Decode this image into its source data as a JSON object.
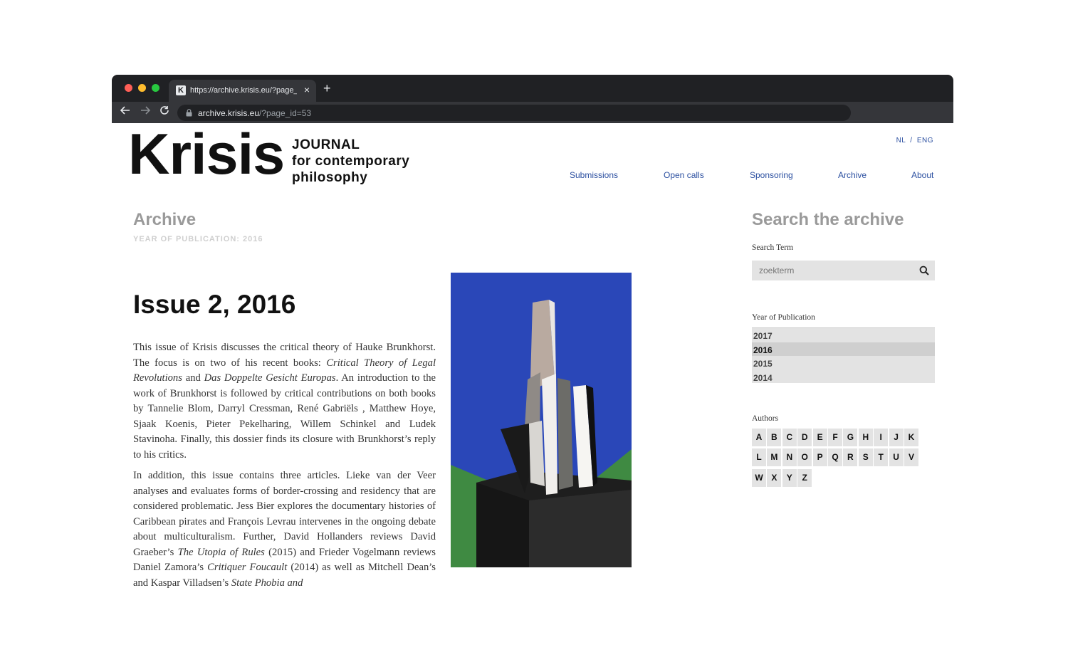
{
  "browser": {
    "tab_title": "https://archive.krisis.eu/?page_",
    "tab_close": "×",
    "new_tab": "+",
    "url_host": "archive.krisis.eu",
    "url_path": "/?page_id=53",
    "favicon_letter": "K"
  },
  "header": {
    "logo_word": "Krisis",
    "logo_tagline": [
      "JOURNAL",
      "for contemporary",
      "philosophy"
    ],
    "lang_nl": "NL",
    "lang_sep": "/",
    "lang_eng": "ENG",
    "nav": [
      "Submissions",
      "Open calls",
      "Sponsoring",
      "Archive",
      "About"
    ]
  },
  "main": {
    "archive_title": "Archive",
    "archive_sub": "YEAR OF PUBLICATION: 2016",
    "issue_title": "Issue 2, 2016",
    "p1": {
      "a": "This issue of Krisis discusses the critical theory of Hauke Brunkhorst. The focus is on two of his recent books: ",
      "i1": "Critical Theory of Legal Revolutions",
      "b": " and ",
      "i2": "Das Doppelte Gesicht Europas",
      "c": ". An introduction to the work of Brunkhorst is followed by critical contributions on both books by Tannelie Blom, Darryl Cressman, René Gabriëls , Matthew Hoye, Sjaak Koenis, Pieter Pekelharing, Willem Schinkel and Ludek Stavinoha. Finally, this dossier finds its closure with Brunkhorst’s reply to his critics."
    },
    "p2": {
      "a": "In addition, this issue contains three articles. Lieke van der Veer analyses and evaluates forms of border-crossing and residency that are considered problematic. Jess Bier explores the documentary histories of Caribbean pirates and François Levrau intervenes in the ongoing debate about multiculturalism. Further, David Hollanders reviews David Graeber’s  ",
      "i1": "The Utopia of Rules",
      "b": " (2015) and Frieder Vogelmann reviews Daniel Zamora’s ",
      "i2": "Critiquer Foucault",
      "c": " (2014) as well as Mitchell Dean’s and Kaspar Villadsen’s ",
      "i3": "State Phobia and"
    }
  },
  "sidebar": {
    "title": "Search the archive",
    "search_label": "Search Term",
    "search_placeholder": "zoekterm",
    "year_label": "Year of Publication",
    "years": [
      "2017",
      "2016",
      "2015",
      "2014"
    ],
    "selected_year": "2016",
    "authors_label": "Authors",
    "letters": [
      "A",
      "B",
      "C",
      "D",
      "E",
      "F",
      "G",
      "H",
      "I",
      "J",
      "K",
      "L",
      "M",
      "N",
      "O",
      "P",
      "Q",
      "R",
      "S",
      "T",
      "U",
      "V",
      "W",
      "X",
      "Y",
      "Z"
    ]
  },
  "colors": {
    "link": "#2b4fa0",
    "muted_heading": "#9a9a9a",
    "chrome_dark": "#202124",
    "chrome_bar": "#35363a",
    "cover_blue": "#2a47b8",
    "cover_green": "#3f8a42"
  },
  "icons": [
    "back-arrow-icon",
    "forward-arrow-icon",
    "reload-icon",
    "lock-icon",
    "search-icon",
    "close-icon",
    "plus-icon"
  ]
}
